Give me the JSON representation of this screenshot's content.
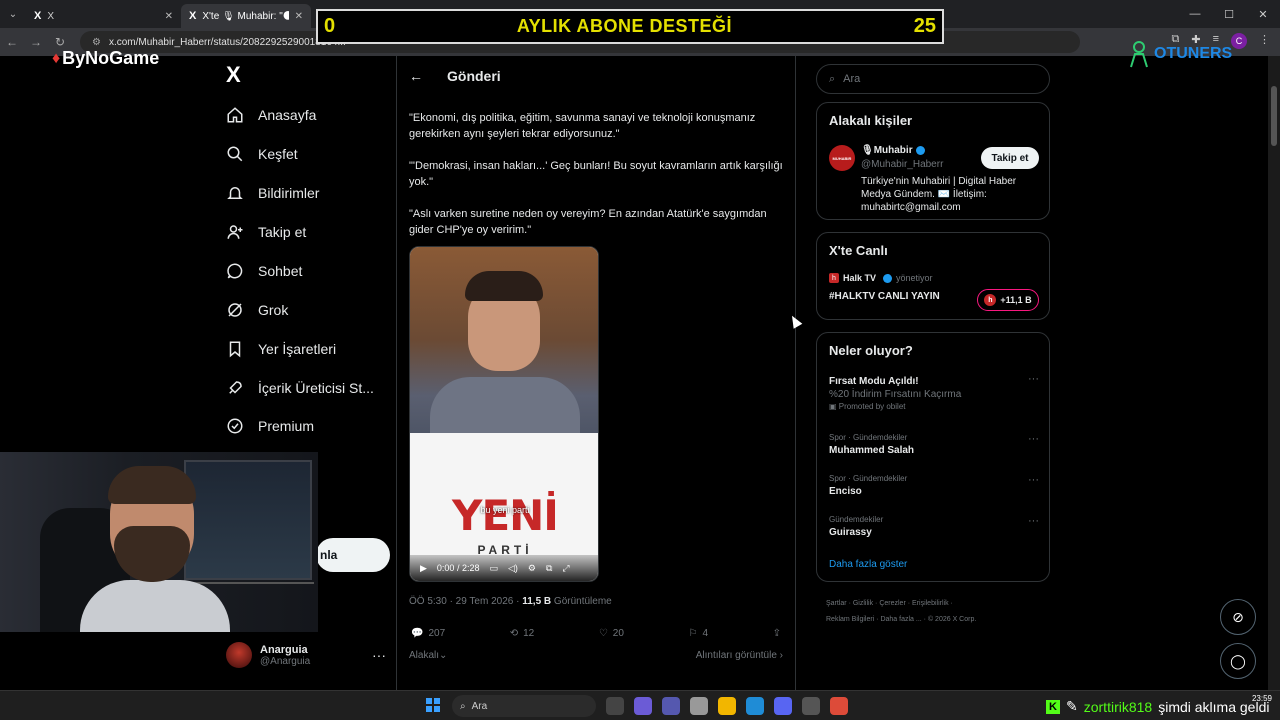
{
  "browser": {
    "tabs": [
      {
        "icon": "X",
        "title": "X"
      },
      {
        "icon": "X",
        "title": "X'te 🎙 Muhabir: \"🌑 Vatandaş"
      }
    ],
    "url": "x.com/Muhabir_Haberr/status/20822925290018164..."
  },
  "overlay": {
    "goal": {
      "left": "0",
      "title": "AYLIK ABONE DESTEĞİ",
      "right": "25"
    },
    "brand_left": "ByNoGame",
    "brand_right": "OTUNERS"
  },
  "nav": {
    "logo": "X",
    "items": [
      {
        "label": "Anasayfa",
        "icon": "home-icon"
      },
      {
        "label": "Keşfet",
        "icon": "search-icon"
      },
      {
        "label": "Bildirimler",
        "icon": "bell-icon"
      },
      {
        "label": "Takip et",
        "icon": "add-person-icon"
      },
      {
        "label": "Sohbet",
        "icon": "chat-icon"
      },
      {
        "label": "Grok",
        "icon": "grok-icon"
      },
      {
        "label": "Yer İşaretleri",
        "icon": "bookmark-icon"
      },
      {
        "label": "İçerik Üreticisi St...",
        "icon": "rocket-icon"
      },
      {
        "label": "Premium",
        "icon": "verified-icon"
      }
    ],
    "post_button": "nla",
    "profile": {
      "name": "Anarguia",
      "handle": "@Anarguia"
    }
  },
  "post": {
    "header": "Gönderi",
    "paragraphs": [
      "\"Ekonomi, dış politika, eğitim, savunma sanayi ve teknoloji konuşmanız gerekirken aynı şeyleri tekrar ediyorsunuz.\"",
      "\"'Demokrasi, insan hakları...' Geç bunları! Bu soyut kavramların artık karşılığı yok.\"",
      "\"Aslı varken suretine neden oy vereyim? En azından Atatürk'e saygımdan gider CHP'ye oy veririm.\""
    ],
    "video": {
      "logo_big": "YENİ",
      "logo_small": "PARTİ",
      "caption": "bu yeni parti",
      "time": "0:00 / 2:28"
    },
    "meta": {
      "time": "ÖÖ 5:30 · 29 Tem 2026 · ",
      "views": "11,5 B",
      "views_label": " Görüntüleme"
    },
    "actions": {
      "replies": "207",
      "reposts": "12",
      "likes": "20",
      "bookmarks": "4"
    },
    "relevance": "Alakalı",
    "quotes": "Alıntıları görüntüle"
  },
  "sidebar": {
    "search_placeholder": "Ara",
    "relevant": {
      "title": "Alakalı kişiler",
      "name": "🎙Muhabir",
      "handle": "@Muhabir_Haberr",
      "follow": "Takip et",
      "bio": "Türkiye'nin Muhabiri | Digital Haber Medya Gündem. ✉️ İletişim: muhabirtc@gmail.com",
      "avatar_text": "MUHABIR"
    },
    "live": {
      "title": "X'te Canlı",
      "source": "Halk TV",
      "source_suffix": "yönetiyor",
      "stream_title": "#HALKTV CANLI YAYIN",
      "count": "+11,1 B"
    },
    "trends": {
      "title": "Neler oluyor?",
      "items": [
        {
          "category": "",
          "name": "Fırsat Modu Açıldı!",
          "sub": "%20 İndirim Fırsatını Kaçırma",
          "promo": "Promoted by obilet"
        },
        {
          "category": "Spor · Gündemdekiler",
          "name": "Muhammed Salah",
          "sub": "",
          "promo": ""
        },
        {
          "category": "Spor · Gündemdekiler",
          "name": "Enciso",
          "sub": "",
          "promo": ""
        },
        {
          "category": "Gündemdekiler",
          "name": "Guirassy",
          "sub": "",
          "promo": ""
        }
      ],
      "show_more": "Daha fazla göster"
    },
    "footer": [
      "Şartlar",
      "Gizlilik",
      "Çerezler",
      "Erişilebilirlik",
      "Reklam Bilgileri",
      "Daha fazla ...",
      "© 2026 X Corp."
    ]
  },
  "taskbar": {
    "search": "Ara",
    "clock": "23:59"
  },
  "chat": {
    "user": "zorttirik818",
    "message": "şimdi aklıma geldi"
  },
  "colors": {
    "accent": "#1d9bf0",
    "goal_text": "#e4e000",
    "kick": "#53fc18"
  }
}
